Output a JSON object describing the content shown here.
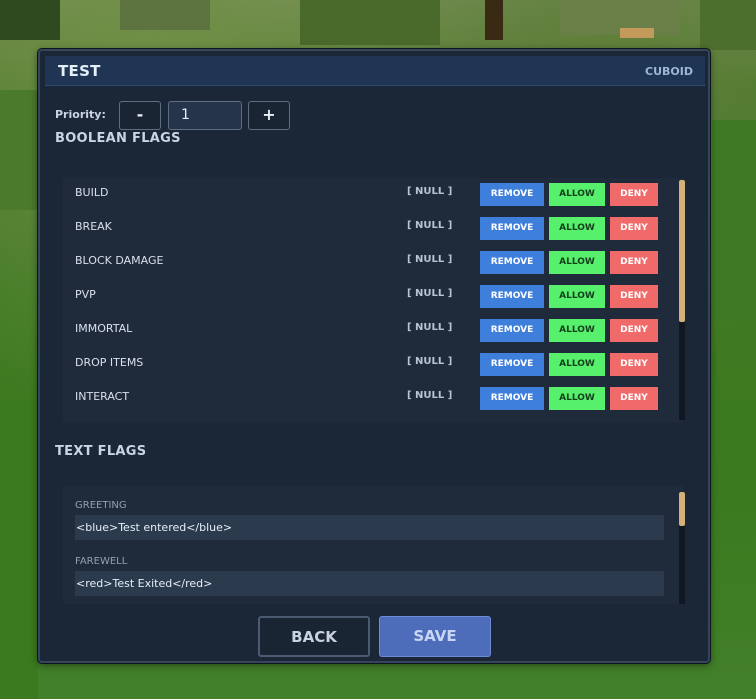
{
  "window": {
    "title": "TEST",
    "subtitle": "CUBOID"
  },
  "priority": {
    "label": "Priority:",
    "decrement_label": "-",
    "value": "1",
    "increment_label": "+"
  },
  "boolean_flags": {
    "heading": "BOOLEAN FLAGS",
    "remove_label": "REMOVE",
    "allow_label": "ALLOW",
    "deny_label": "DENY",
    "items": [
      {
        "name": "BUILD",
        "status": "[ NULL ]"
      },
      {
        "name": "BREAK",
        "status": "[ NULL ]"
      },
      {
        "name": "BLOCK DAMAGE",
        "status": "[ NULL ]"
      },
      {
        "name": "PVP",
        "status": "[ NULL ]"
      },
      {
        "name": "IMMORTAL",
        "status": "[ NULL ]"
      },
      {
        "name": "DROP ITEMS",
        "status": "[ NULL ]"
      },
      {
        "name": "INTERACT",
        "status": "[ NULL ]"
      }
    ]
  },
  "text_flags": {
    "heading": "TEXT FLAGS",
    "items": [
      {
        "label": "GREETING",
        "value": "<blue>Test entered</blue>"
      },
      {
        "label": "FAREWELL",
        "value": "<red>Test Exited</red>"
      }
    ]
  },
  "footer": {
    "back_label": "BACK",
    "save_label": "SAVE"
  },
  "colors": {
    "panel_bg": "#1b2636",
    "titlebar_bg": "#1f3553",
    "remove_button": "#3f7fdc",
    "allow_button": "#56f06c",
    "deny_button": "#f06a6a",
    "scrollbar_thumb": "#d3b27a",
    "save_button": "#4d6dbb"
  }
}
